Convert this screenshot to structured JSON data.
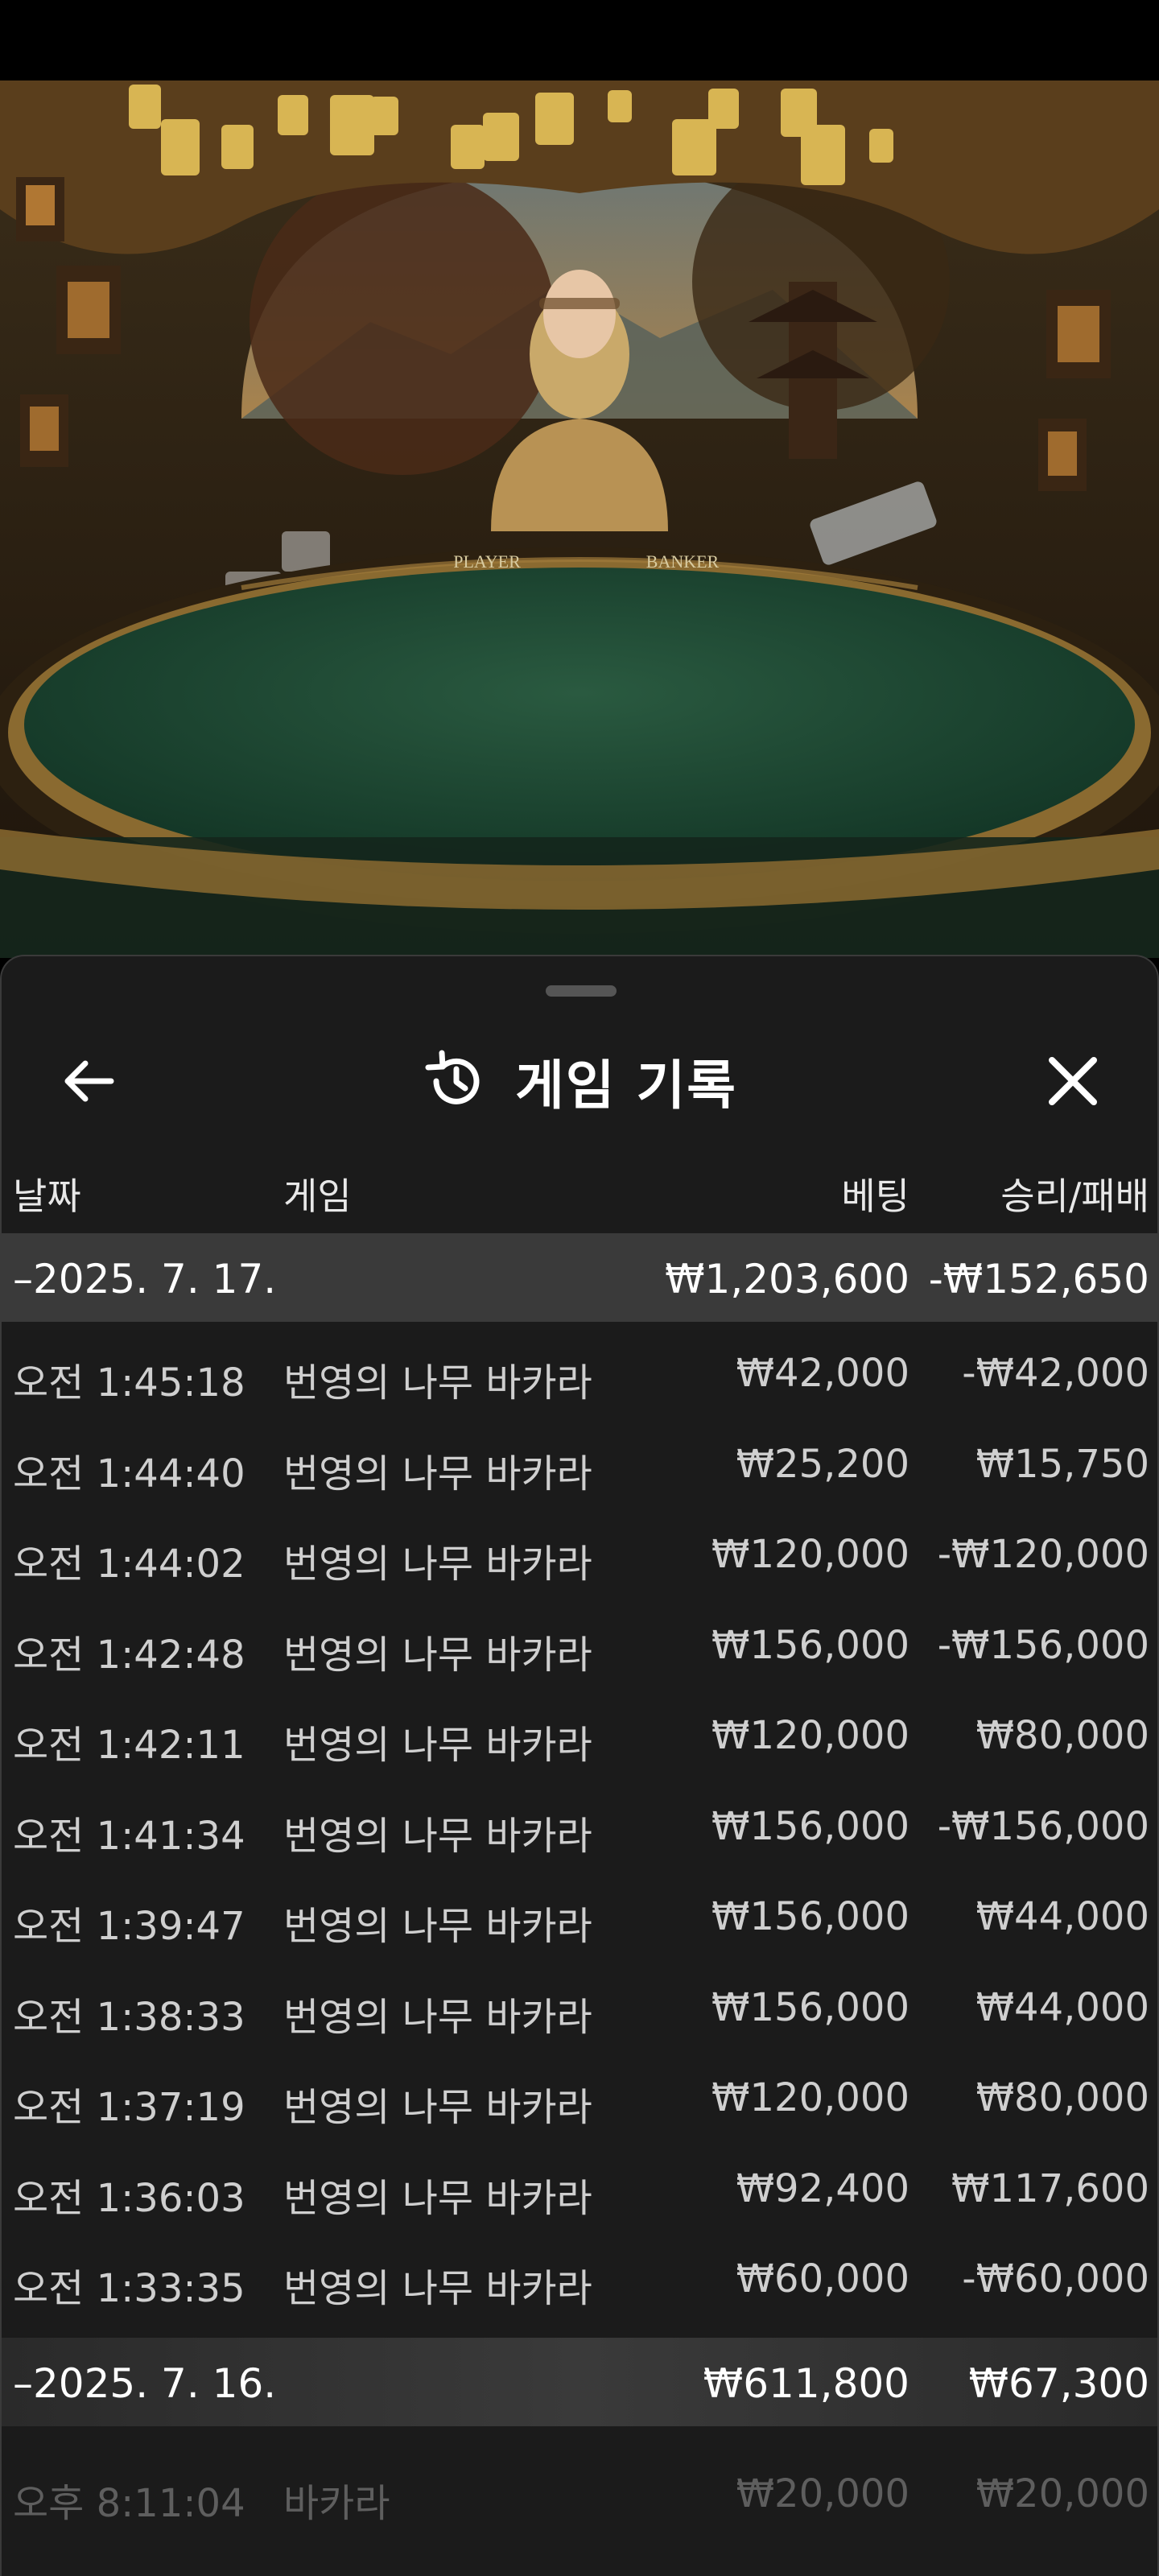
{
  "header": {
    "title": "게임 기록",
    "back_icon": "arrow-left-icon",
    "close_icon": "close-icon",
    "history_icon": "history-icon"
  },
  "columns": {
    "date": "날짜",
    "game": "게임",
    "bet": "베팅",
    "win_loss": "승리/패배"
  },
  "groups": [
    {
      "date": "–2025. 7. 17.",
      "total_bet": "₩1,203,600",
      "total_result": "-₩152,650",
      "rows": [
        {
          "time": "오전 1:45:18",
          "game": "번영의 나무 바카라",
          "bet": "₩42,000",
          "result": "-₩42,000"
        },
        {
          "time": "오전 1:44:40",
          "game": "번영의 나무 바카라",
          "bet": "₩25,200",
          "result": "₩15,750"
        },
        {
          "time": "오전 1:44:02",
          "game": "번영의 나무 바카라",
          "bet": "₩120,000",
          "result": "-₩120,000"
        },
        {
          "time": "오전 1:42:48",
          "game": "번영의 나무 바카라",
          "bet": "₩156,000",
          "result": "-₩156,000"
        },
        {
          "time": "오전 1:42:11",
          "game": "번영의 나무 바카라",
          "bet": "₩120,000",
          "result": "₩80,000"
        },
        {
          "time": "오전 1:41:34",
          "game": "번영의 나무 바카라",
          "bet": "₩156,000",
          "result": "-₩156,000"
        },
        {
          "time": "오전 1:39:47",
          "game": "번영의 나무 바카라",
          "bet": "₩156,000",
          "result": "₩44,000"
        },
        {
          "time": "오전 1:38:33",
          "game": "번영의 나무 바카라",
          "bet": "₩156,000",
          "result": "₩44,000"
        },
        {
          "time": "오전 1:37:19",
          "game": "번영의 나무 바카라",
          "bet": "₩120,000",
          "result": "₩80,000"
        },
        {
          "time": "오전 1:36:03",
          "game": "번영의 나무 바카라",
          "bet": "₩92,400",
          "result": "₩117,600"
        },
        {
          "time": "오전 1:33:35",
          "game": "번영의 나무 바카라",
          "bet": "₩60,000",
          "result": "-₩60,000"
        }
      ]
    },
    {
      "date": "–2025. 7. 16.",
      "total_bet": "₩611,800",
      "total_result": "₩67,300",
      "rows": [
        {
          "time": "오후 8:11:04",
          "game": "바카라",
          "bet": "₩20,000",
          "result": "₩20,000"
        }
      ]
    }
  ],
  "table_labels": {
    "player": "PLAYER",
    "banker": "BANKER"
  },
  "colors": {
    "sheet_bg": "#1b1b1b",
    "date_row_bg": "#3a3a3a",
    "table_felt": "#1f4a34"
  }
}
